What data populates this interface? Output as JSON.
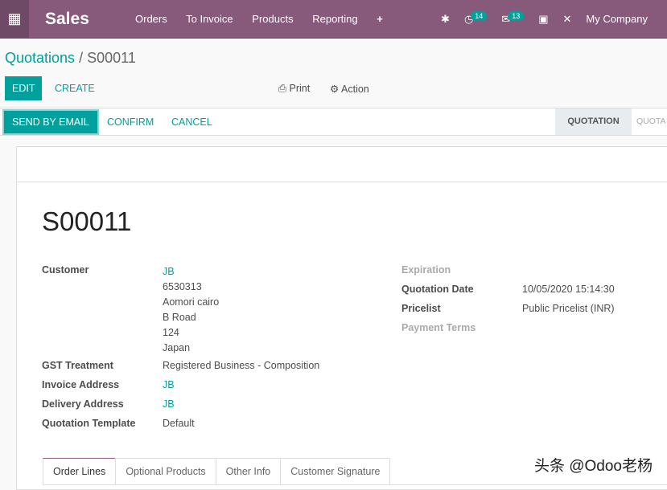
{
  "nav": {
    "app": "Sales",
    "menu": [
      "Orders",
      "To Invoice",
      "Products",
      "Reporting"
    ],
    "activity_count": "14",
    "message_count": "13",
    "company": "My Company"
  },
  "breadcrumb": {
    "parent": "Quotations",
    "separator": "/",
    "current": "S00011"
  },
  "actions": {
    "edit": "EDIT",
    "create": "CREATE",
    "print": "Print",
    "action": "Action"
  },
  "status": {
    "send": "SEND BY EMAIL",
    "confirm": "CONFIRM",
    "cancel": "CANCEL",
    "stages": [
      "QUOTATION",
      "QUOTA"
    ]
  },
  "record": {
    "name": "S00011",
    "left": [
      {
        "label": "Customer",
        "lines": [
          "JB",
          "6530313",
          "Aomori cairo",
          "B Road",
          "124",
          "Japan"
        ]
      },
      {
        "label": "GST Treatment",
        "value": "Registered Business - Composition"
      },
      {
        "label": "Invoice Address",
        "value": "JB"
      },
      {
        "label": "Delivery Address",
        "value": "JB"
      },
      {
        "label": "Quotation Template",
        "value": "Default"
      }
    ],
    "right": [
      {
        "label": "Expiration",
        "value": ""
      },
      {
        "label": "Quotation Date",
        "value": "10/05/2020 15:14:30"
      },
      {
        "label": "Pricelist",
        "value": "Public Pricelist (INR)"
      },
      {
        "label": "Payment Terms",
        "value": ""
      }
    ]
  },
  "tabs": [
    "Order Lines",
    "Optional Products",
    "Other Info",
    "Customer Signature"
  ],
  "watermark": "头条 @Odoo老杨"
}
